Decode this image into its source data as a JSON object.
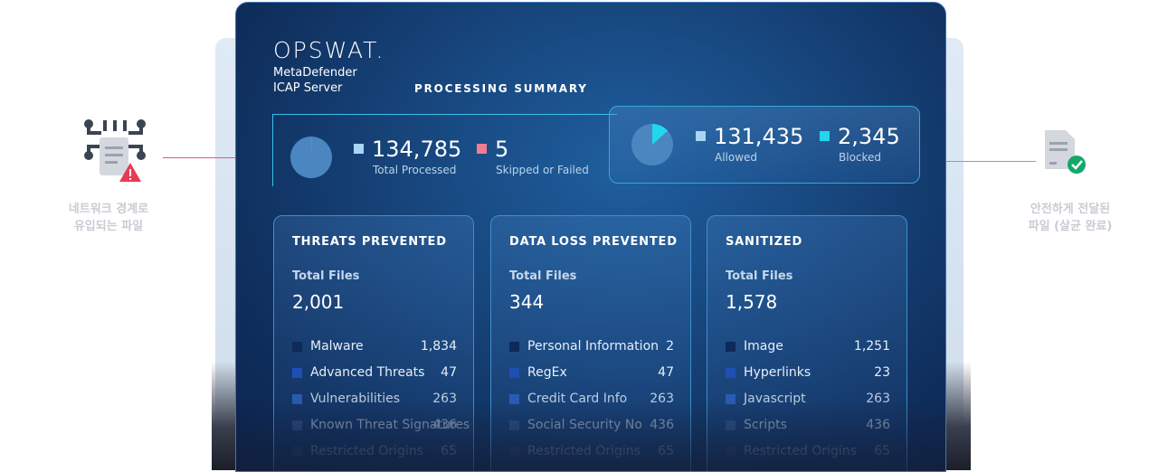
{
  "brand": {
    "logo": "OPSWAT.",
    "product_line1": "MetaDefender",
    "product_line2": "ICAP Server"
  },
  "summary": {
    "title": "PROCESSING SUMMARY",
    "total_processed": {
      "value": "134,785",
      "label": "Total Processed",
      "color": "#a9d4f5"
    },
    "skipped": {
      "value": "5",
      "label": "Skipped or Failed",
      "color": "#f07c93"
    },
    "allowed": {
      "value": "131,435",
      "label": "Allowed",
      "color": "#a9d4f5"
    },
    "blocked": {
      "value": "2,345",
      "label": "Blocked",
      "color": "#22d6ee"
    }
  },
  "cards": [
    {
      "title": "THREATS PREVENTED",
      "total_label": "Total Files",
      "total": "2,001",
      "rows": [
        {
          "label": "Malware",
          "value": "1,834"
        },
        {
          "label": "Advanced Threats",
          "value": "47"
        },
        {
          "label": "Vulnerabilities",
          "value": "263"
        },
        {
          "label": "Known Threat Signatures",
          "value": "436"
        },
        {
          "label": "Restricted Origins",
          "value": "65"
        }
      ]
    },
    {
      "title": "DATA LOSS PREVENTED",
      "total_label": "Total Files",
      "total": "344",
      "rows": [
        {
          "label": "Personal Information",
          "value": "2"
        },
        {
          "label": "RegEx",
          "value": "47"
        },
        {
          "label": "Credit Card Info",
          "value": "263"
        },
        {
          "label": "Social Security No",
          "value": "436"
        },
        {
          "label": "Restricted Origins",
          "value": "65"
        }
      ]
    },
    {
      "title": "SANITIZED",
      "total_label": "Total Files",
      "total": "1,578",
      "rows": [
        {
          "label": "Image",
          "value": "1,251"
        },
        {
          "label": "Hyperlinks",
          "value": "23"
        },
        {
          "label": "Javascript",
          "value": "263"
        },
        {
          "label": "Scripts",
          "value": "436"
        },
        {
          "label": "Restricted Origins",
          "value": "65"
        }
      ]
    }
  ],
  "side": {
    "left_line1": "네트워크 경계로",
    "left_line2": "유입되는 파일",
    "right_line1": "안전하게 전달된",
    "right_line2": "파일 (살균 완료)"
  },
  "colors": {
    "row_square_1": "#0e2a5a",
    "row_square_2": "#1f4fb4",
    "row_square_3": "#2f62c4",
    "row_square_4": "#3a5e9a",
    "row_square_5": "#3a4f78",
    "left_connector": "#e8557a",
    "right_connector": "#36c0e8"
  }
}
